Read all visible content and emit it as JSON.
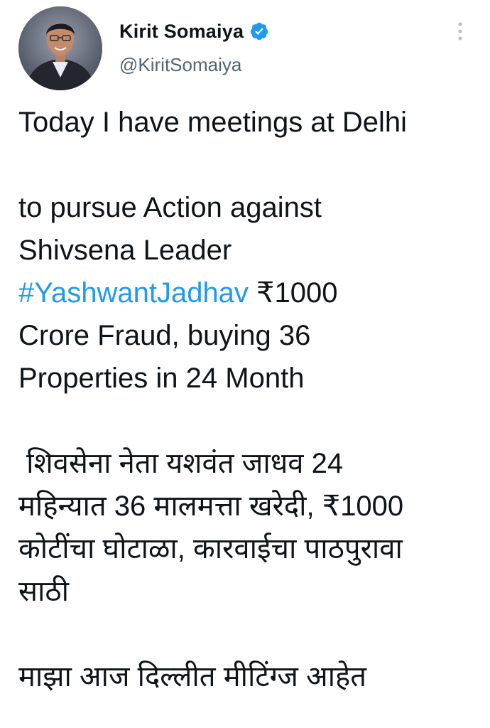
{
  "author": {
    "display_name": "Kirit Somaiya",
    "handle": "@KiritSomaiya",
    "verified": true,
    "avatar_icon": "profile-photo"
  },
  "menu": {
    "icon": "more-vertical-icon"
  },
  "colors": {
    "text": "#0f1419",
    "secondary": "#536471",
    "link": "#1d9bf0",
    "verified": "#1d9bf0"
  },
  "tweet": {
    "line1": "Today I have meetings at Delhi",
    "line2": "to pursue Action against",
    "line3": "Shivsena Leader",
    "hashtag": "#YashwantJadhav",
    "line4_rest": " ₹1000",
    "line5": "Crore Fraud, buying 36",
    "line6": "Properties in 24 Month",
    "mr_line1": " शिवसेना नेता यशवंत जाधव 24",
    "mr_line2": "महिन्यात 36 मालमत्ता खरेदी, ₹1000",
    "mr_line3": "कोटींचा घोटाळा, कारवाईचा पाठपुरावा",
    "mr_line4": "साठी",
    "mr_line5": "माझा आज दिल्लीत मीटिंग्ज आहेत"
  }
}
